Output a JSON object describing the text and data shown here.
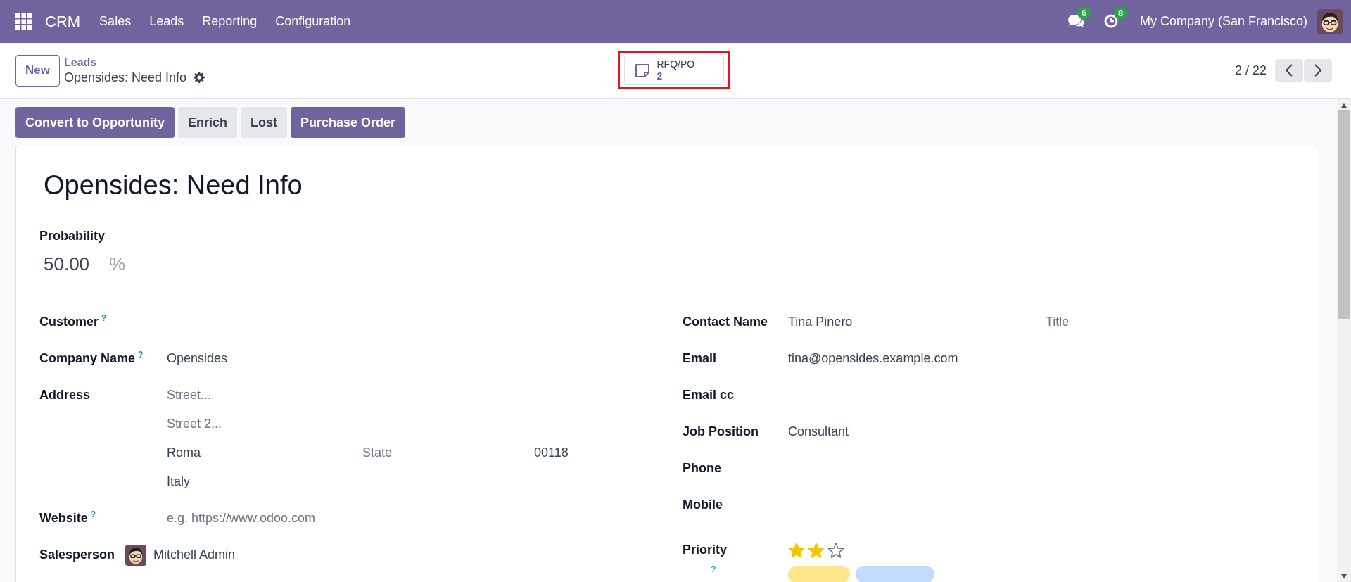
{
  "navbar": {
    "app_name": "CRM",
    "menu": [
      "Sales",
      "Leads",
      "Reporting",
      "Configuration"
    ],
    "messages_badge": "6",
    "activities_badge": "8",
    "company": "My Company (San Francisco)"
  },
  "control_panel": {
    "new_button": "New",
    "breadcrumb": "Leads",
    "record_title": "Opensides: Need Info",
    "smart_button": {
      "label": "RFQ/PO",
      "count": "2"
    },
    "pager": "2 / 22"
  },
  "actions": [
    {
      "label": "Convert to Opportunity",
      "primary": true
    },
    {
      "label": "Enrich",
      "primary": false
    },
    {
      "label": "Lost",
      "primary": false
    },
    {
      "label": "Purchase Order",
      "primary": true
    }
  ],
  "form": {
    "title": "Opensides: Need Info",
    "probability": {
      "label": "Probability",
      "value": "50.00",
      "unit": "%"
    },
    "left_fields": [
      {
        "label": "Customer",
        "help": "?",
        "kind": "lines"
      },
      {
        "label": "Company Name",
        "help": "?",
        "kind": "lines",
        "lines": [
          [
            {
              "value": "Opensides"
            }
          ]
        ]
      },
      {
        "label": "Address",
        "kind": "lines",
        "lines": [
          [
            {
              "placeholder": "Street..."
            }
          ],
          [
            {
              "placeholder": "Street 2..."
            }
          ],
          [
            {
              "value": "Roma"
            },
            {
              "placeholder": "State"
            },
            {
              "value": "00118"
            }
          ],
          [
            {
              "value": "Italy"
            }
          ]
        ]
      },
      {
        "label": "Website",
        "help": "?",
        "kind": "lines",
        "lines": [
          [
            {
              "placeholder": "e.g. https://www.odoo.com"
            }
          ]
        ]
      },
      {
        "label": "Salesperson",
        "kind": "user",
        "value": "Mitchell Admin"
      }
    ],
    "right_fields": [
      {
        "label": "Contact Name",
        "kind": "lines",
        "lines": [
          [
            {
              "value": "Tina Pinero"
            },
            {
              "placeholder": "Title"
            }
          ]
        ]
      },
      {
        "label": "Email",
        "kind": "lines",
        "lines": [
          [
            {
              "value": "tina@opensides.example.com"
            }
          ]
        ]
      },
      {
        "label": "Email cc",
        "kind": "lines"
      },
      {
        "label": "Job Position",
        "kind": "lines",
        "lines": [
          [
            {
              "value": "Consultant"
            }
          ]
        ]
      },
      {
        "label": "Phone",
        "kind": "lines"
      },
      {
        "label": "Mobile",
        "kind": "lines"
      },
      {
        "label": "Priority",
        "kind": "stars",
        "stars": 2
      },
      {
        "help": "?",
        "kind": "tags",
        "tags": [
          {
            "color": "#fde68a"
          },
          {
            "color": "#bfdbfe"
          }
        ]
      }
    ]
  }
}
